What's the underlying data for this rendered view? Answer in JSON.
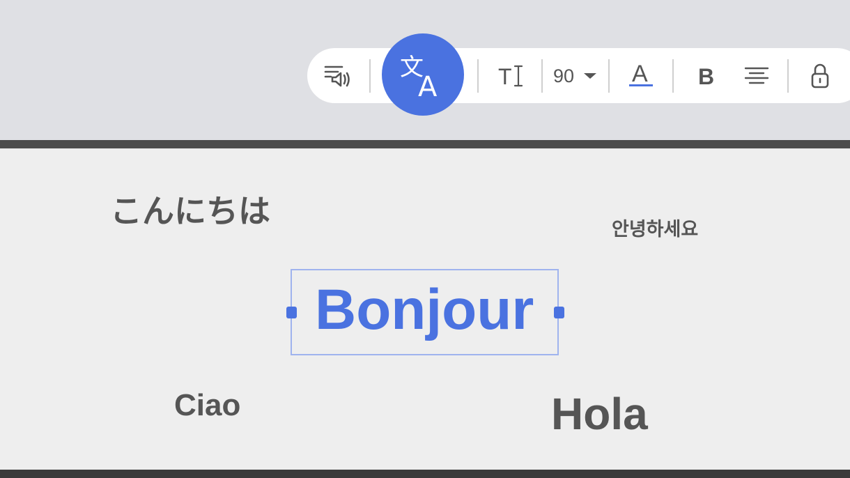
{
  "toolbar": {
    "font_size_value": "90",
    "accent_color": "#4a72e0",
    "icons": [
      "text-to-speech-icon",
      "translate-icon",
      "text-cursor-icon",
      "dropdown-arrow-icon",
      "text-color-icon",
      "bold-icon",
      "align-center-icon",
      "lock-icon"
    ],
    "translate_glyph": "文",
    "translate_letter": "A",
    "text_tool_letter": "T",
    "text_color_letter": "A",
    "bold_letter": "B"
  },
  "canvas": {
    "words": {
      "japanese": "こんにちは",
      "korean": "안녕하세요",
      "french": "Bonjour",
      "italian": "Ciao",
      "spanish": "Hola"
    }
  }
}
